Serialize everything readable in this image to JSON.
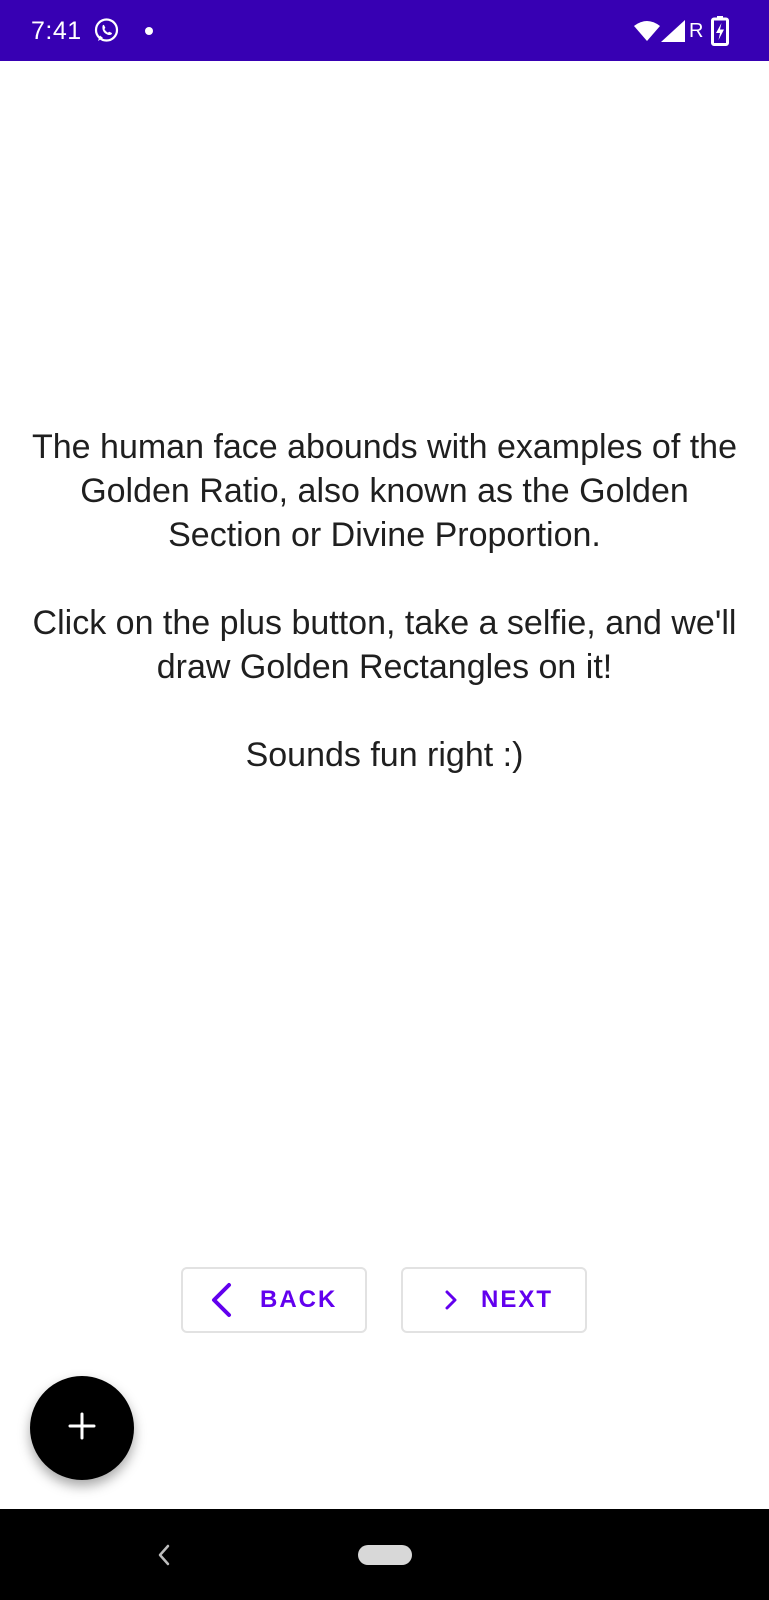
{
  "status_bar": {
    "time": "7:41",
    "roaming": "R",
    "background": "#3700b3",
    "icons": [
      "whatsapp-icon",
      "notification-dot",
      "wifi-icon",
      "signal-icon",
      "battery-charging-icon"
    ]
  },
  "content": {
    "paragraph_1": "The human face abounds with examples of the Golden Ratio, also known as the Golden Section or Divine Proportion.",
    "paragraph_2": "Click on the plus button, take a selfie, and we'll draw Golden Rectangles on it!",
    "paragraph_3": "Sounds fun right :)"
  },
  "buttons": {
    "back_label": "BACK",
    "next_label": "NEXT",
    "accent": "#6200ee"
  },
  "fab": {
    "icon": "plus-icon",
    "color": "#000000"
  },
  "nav_bar": {
    "icons": [
      "nav-back-icon",
      "nav-home-pill"
    ]
  }
}
